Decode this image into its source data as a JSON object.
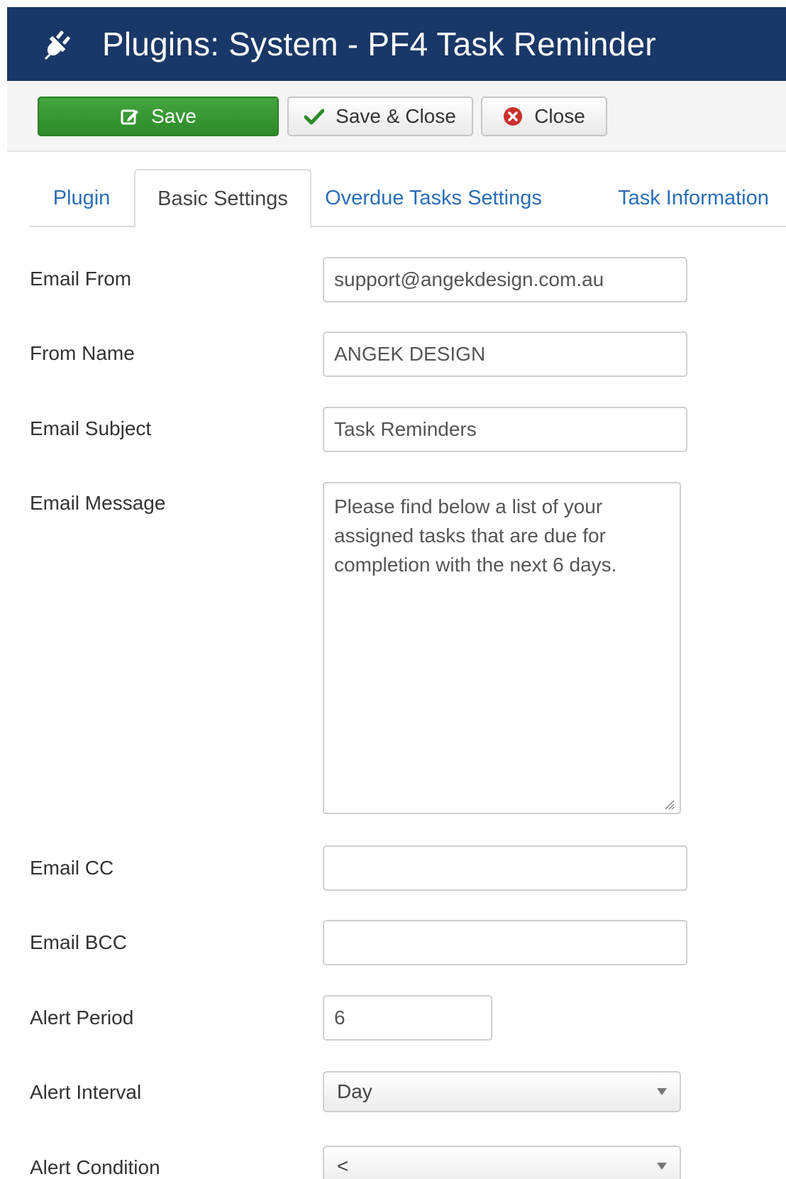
{
  "header": {
    "title": "Plugins: System - PF4 Task Reminder",
    "icon": "plug-icon",
    "background": "#1a3867"
  },
  "toolbar": {
    "save_label": "Save",
    "save_close_label": "Save & Close",
    "close_label": "Close",
    "save_color": "#3a9a36"
  },
  "tabs": [
    {
      "label": "Plugin",
      "active": false
    },
    {
      "label": "Basic Settings",
      "active": true
    },
    {
      "label": "Overdue Tasks Settings",
      "active": false
    },
    {
      "label": "Task Information",
      "active": false
    }
  ],
  "form": {
    "email_from": {
      "label": "Email From",
      "value": "support@angekdesign.com.au"
    },
    "from_name": {
      "label": "From Name",
      "value": "ANGEK DESIGN"
    },
    "email_subject": {
      "label": "Email Subject",
      "value": "Task Reminders"
    },
    "email_message": {
      "label": "Email Message",
      "value": "Please find below a list of your assigned tasks that are due for completion with the next 6 days."
    },
    "email_cc": {
      "label": "Email CC",
      "value": ""
    },
    "email_bcc": {
      "label": "Email BCC",
      "value": ""
    },
    "alert_period": {
      "label": "Alert Period",
      "value": "6"
    },
    "alert_interval": {
      "label": "Alert Interval",
      "value": "Day"
    },
    "alert_condition": {
      "label": "Alert Condition",
      "value": "<"
    }
  }
}
